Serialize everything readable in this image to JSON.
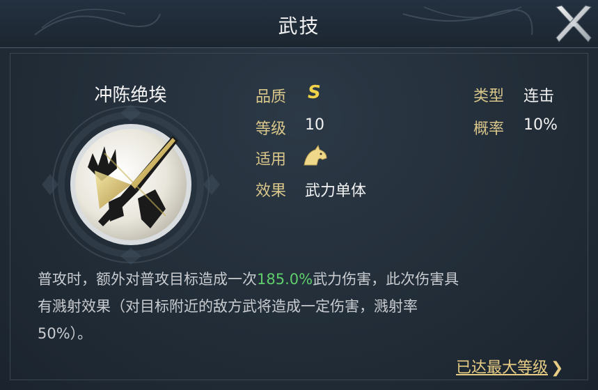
{
  "header": {
    "title": "武技"
  },
  "skill": {
    "name": "冲陈绝埃",
    "attributes": {
      "quality_label": "品质",
      "quality_value": "S",
      "level_label": "等级",
      "level_value": "10",
      "applies_label": "适用",
      "applies_icon": "horse-icon",
      "effect_label": "效果",
      "effect_value": "武力单体",
      "type_label": "类型",
      "type_value": "连击",
      "chance_label": "概率",
      "chance_value": "10%"
    },
    "description": {
      "line1_pre": "普攻时，额外对普攻目标造成一次",
      "line1_highlight": "185.0%",
      "line1_post": "武力伤害，此次伤害具",
      "line2": "有溅射效果（对目标附近的敌方武将造成一定伤害，溅射率",
      "line3": "50%）。"
    },
    "max_level_link": "已达最大等级",
    "max_level_chevron": "❯"
  },
  "colors": {
    "highlight": "#5fcf6b",
    "label_gold": "#d9c68a",
    "grade_gold": "#f0d24a",
    "link_gold": "#e7cd84"
  }
}
